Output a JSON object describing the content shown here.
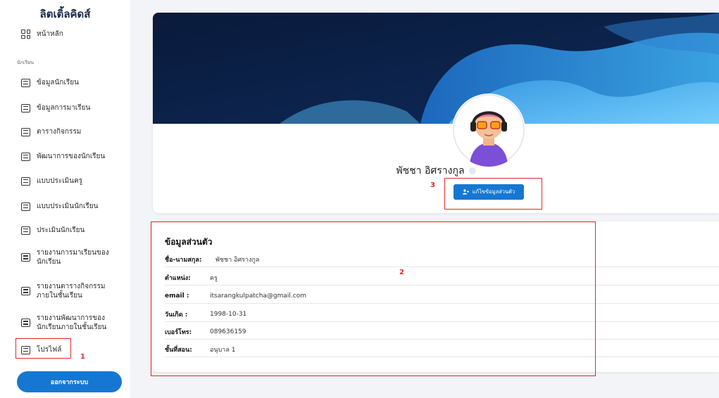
{
  "sidebar": {
    "brand": "ลิตเติ้ลคิดส์",
    "home": "หน้าหลัก",
    "section": "นักเรียน",
    "items": [
      {
        "label": "ข้อมูลนักเรียน"
      },
      {
        "label": "ข้อมูลการมาเรียน"
      },
      {
        "label": "ตารางกิจกรรม"
      },
      {
        "label": "พัฒนาการของนักเรียน"
      },
      {
        "label": "แบบประเมินครู"
      },
      {
        "label": "แบบประเมินนักเรียน"
      },
      {
        "label": "ประเมินนักเรียน"
      },
      {
        "label": "รายงานการมาเรียนของนักเรียน"
      },
      {
        "label": "รายงานตารางกิจกรรมภายในชั้นเรียน"
      },
      {
        "label": "รายงานพัฒนาการของนักเรียนภายในชั้นเรียน"
      },
      {
        "label": "โปรไฟล์"
      }
    ],
    "logout": "ออกจากระบบ"
  },
  "profile": {
    "name": "พัชชา อิศรางกูล",
    "edit_button": "แก้ไขข้อมูลส่วนตัว"
  },
  "info": {
    "title": "ข้อมูลส่วนตัว",
    "rows": [
      {
        "label": "ชื่อ-นามสกุล:",
        "value": "พัชชา อิศรางกูล"
      },
      {
        "label": "ตำแหน่ง:",
        "value": "ครู"
      },
      {
        "label": "email :",
        "value": "itsarangkulpatcha@gmail.com"
      },
      {
        "label": "วันเกิด :",
        "value": "1998-10-31"
      },
      {
        "label": "เบอร์โทร:",
        "value": "089636159"
      },
      {
        "label": "ชั้นที่สอน:",
        "value": "อนุบาล 1"
      }
    ]
  },
  "annotations": {
    "one": "1",
    "two": "2",
    "three": "3"
  },
  "colors": {
    "primary": "#1677d2",
    "annotation": "#e02828",
    "banner_dark": "#0b1a3c",
    "banner_wave": "#2a8fd8"
  }
}
